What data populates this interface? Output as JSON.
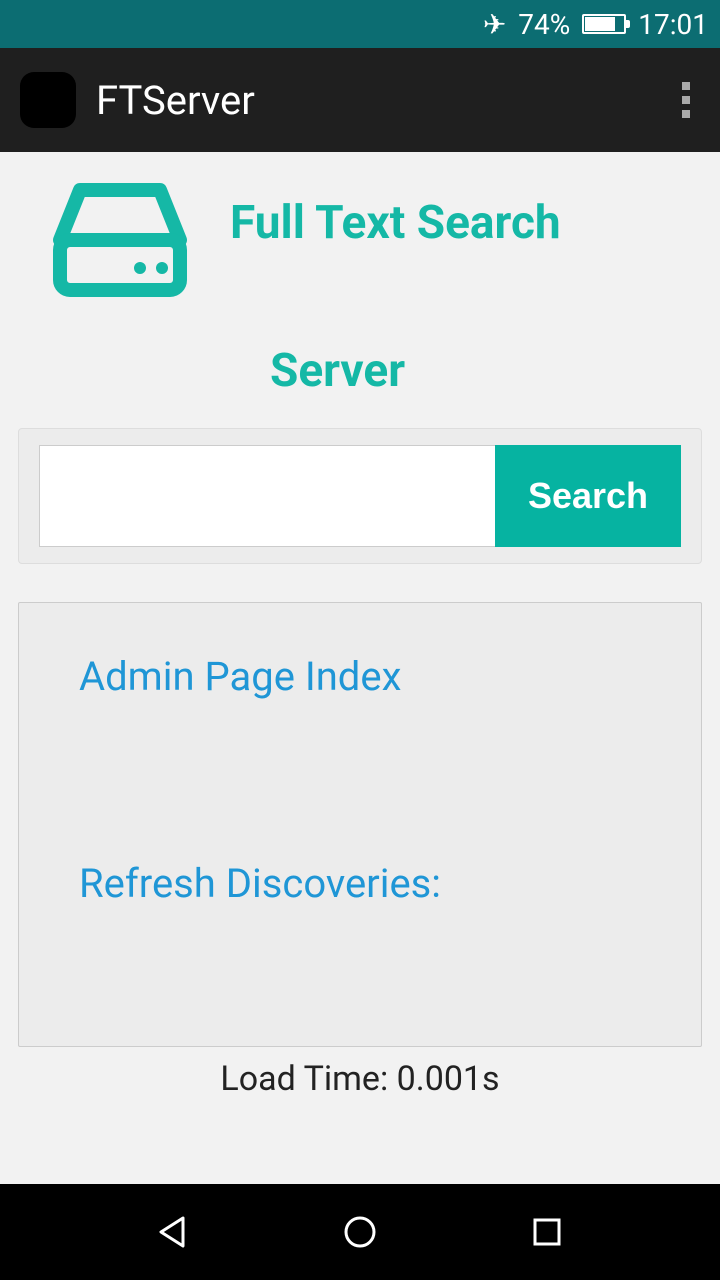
{
  "status_bar": {
    "battery_percent": "74%",
    "time": "17:01"
  },
  "app_bar": {
    "title": "FTServer"
  },
  "hero": {
    "title_line1": "Full Text Search",
    "title_line2": "Server"
  },
  "search": {
    "input_value": "",
    "button_label": "Search"
  },
  "panel": {
    "link_admin": "Admin Page Index",
    "link_refresh": "Refresh Discoveries:"
  },
  "footer": {
    "load_time": "Load Time: 0.001s"
  }
}
